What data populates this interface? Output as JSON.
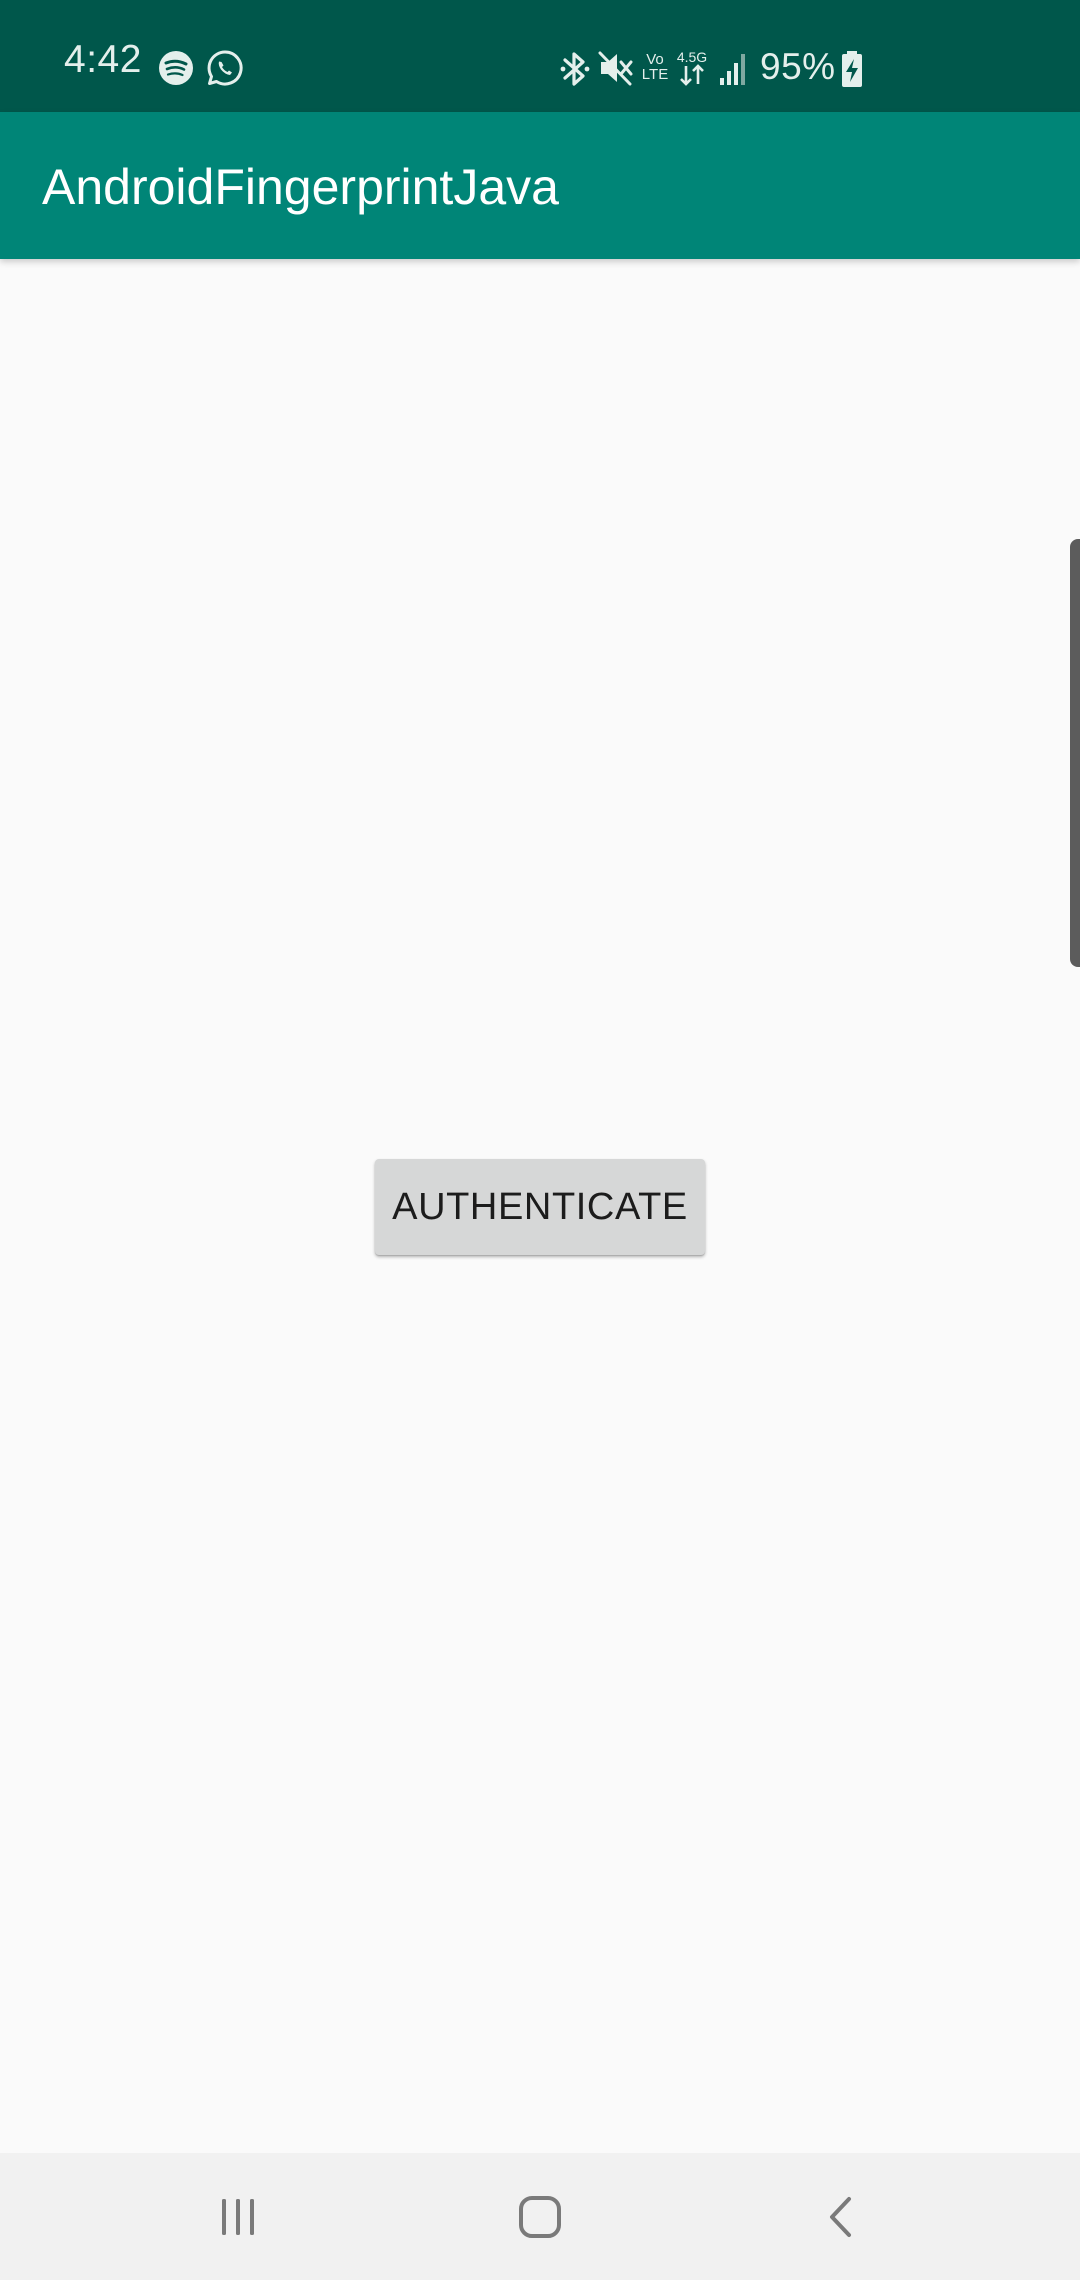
{
  "status_bar": {
    "time": "4:42",
    "battery_percent": "95%",
    "network_volte_top": "Vo",
    "network_volte_bottom": "LTE",
    "network_speed": "4.5G",
    "icons_left": [
      "spotify-icon",
      "whatsapp-icon"
    ],
    "icons_right": [
      "bluetooth-icon",
      "mute-icon",
      "volte-icon",
      "data-arrows-icon",
      "signal-icon",
      "battery-charging-icon"
    ]
  },
  "app_bar": {
    "title": "AndroidFingerprintJava",
    "color": "#008577"
  },
  "main": {
    "authenticate_label": "AUTHENTICATE"
  },
  "nav_bar": {
    "items": [
      "recents-icon",
      "home-icon",
      "back-icon"
    ]
  },
  "colors": {
    "status_bar": "#00574B",
    "app_bar": "#008577",
    "background": "#FAFAFA",
    "button": "#D6D7D7"
  }
}
